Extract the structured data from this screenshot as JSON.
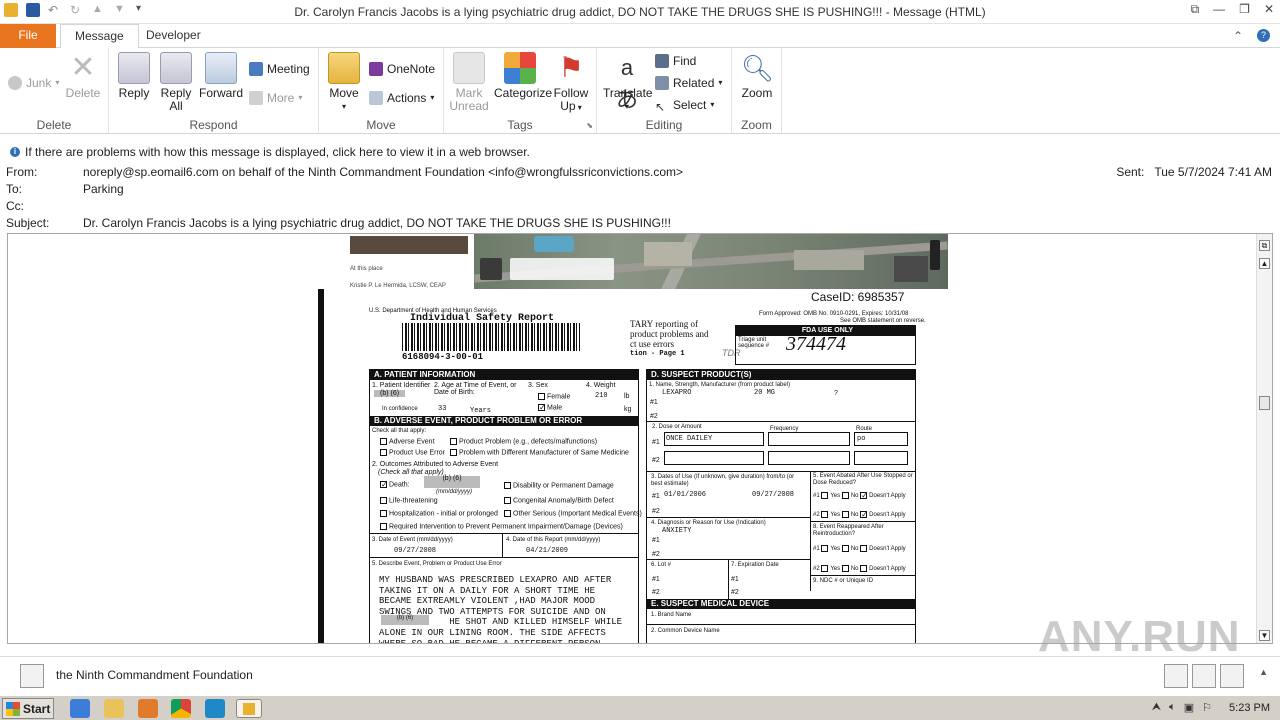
{
  "window": {
    "title": "Dr. Carolyn Francis Jacobs is a lying psychiatric drug addict, DO NOT TAKE THE DRUGS SHE IS PUSHING!!! - Message (HTML)"
  },
  "tabs": {
    "file": "File",
    "message": "Message",
    "developer": "Developer"
  },
  "ribbon": {
    "delete_group": {
      "label": "Delete",
      "junk": "Junk",
      "delete": "Delete"
    },
    "respond_group": {
      "label": "Respond",
      "reply": "Reply",
      "reply_all_1": "Reply",
      "reply_all_2": "All",
      "forward": "Forward",
      "meeting": "Meeting",
      "more": "More"
    },
    "move_group": {
      "label": "Move",
      "move": "Move",
      "onenote": "OneNote",
      "actions": "Actions"
    },
    "tags_group": {
      "label": "Tags",
      "mark_unread_1": "Mark",
      "mark_unread_2": "Unread",
      "categorize": "Categorize",
      "follow_up_1": "Follow",
      "follow_up_2": "Up"
    },
    "editing_group": {
      "label": "Editing",
      "translate": "Translate",
      "find": "Find",
      "related": "Related",
      "select": "Select"
    },
    "zoom_group": {
      "label": "Zoom",
      "zoom": "Zoom"
    }
  },
  "infobar": "If there are problems with how this message is displayed, click here to view it in a web browser.",
  "headers": {
    "from_label": "From:",
    "from": "noreply@sp.eomail6.com on behalf of the Ninth Commandment Foundation <info@wrongfulssriconvictions.com>",
    "to_label": "To:",
    "to": "Parking",
    "cc_label": "Cc:",
    "cc": "",
    "subject_label": "Subject:",
    "subject": "Dr. Carolyn Francis Jacobs is a lying psychiatric drug addict, DO NOT TAKE THE DRUGS SHE IS PUSHING!!!",
    "sent_label": "Sent:",
    "sent": "Tue 5/7/2024 7:41 AM"
  },
  "document": {
    "map_at_place": "At this place",
    "map_person": "Kristie P. Le Hermida, LCSW, CEAP",
    "case_id": "CaseID: 6985357",
    "agency": "U.S. Department of Health and Human Services",
    "form_title": "Individual Safety Report",
    "barcode_number": "6168094-3-00-01",
    "header_text_1": "TARY reporting of",
    "header_text_2": "product problems and",
    "header_text_3": "ct use errors",
    "header_text_4": "tion - Page 1",
    "form_approved": "Form Approved: OMB No. 0910-0291, Expires: 10/31/08",
    "omb_statement": "See OMB statement on reverse.",
    "fda_use_only": "FDA USE ONLY",
    "triage_label": "Triage unit sequence #",
    "triage_value": "374474",
    "sec_a": "A. PATIENT INFORMATION",
    "patient_id_label": "1. Patient Identifier",
    "patient_id_value": "(b) (6)",
    "in_confidence": "In confidence",
    "age_label": "2. Age at Time of Event, or Date of Birth:",
    "age_value": "33",
    "age_unit": "Years",
    "sex_label": "3. Sex",
    "sex_female": "Female",
    "sex_male": "Male",
    "weight_label": "4. Weight",
    "weight_value": "210",
    "weight_lb": "lb",
    "weight_kg": "kg",
    "sec_b": "B. ADVERSE EVENT, PRODUCT PROBLEM OR ERROR",
    "check_all": "Check all that apply:",
    "adverse_event": "Adverse Event",
    "product_problem": "Product Problem (e.g., defects/malfunctions)",
    "product_use_error": "Product Use Error",
    "problem_diff_mfr": "Problem with Different Manufacturer of Same Medicine",
    "outcomes_label": "2. Outcomes Attributed to Adverse Event",
    "outcomes_sub": "(Check all that apply)",
    "death": "Death:",
    "death_redacted": "(b) (6)",
    "date_fmt": "(mm/dd/yyyy)",
    "life_threatening": "Life-threatening",
    "hospitalization": "Hospitalization - initial or prolonged",
    "required_intervention": "Required Intervention to Prevent Permanent Impairment/Damage (Devices)",
    "disability": "Disability or Permanent Damage",
    "congenital": "Congenital Anomaly/Birth Defect",
    "other_serious": "Other Serious (Important Medical Events)",
    "date_event_label": "3. Date of Event (mm/dd/yyyy)",
    "date_event_value": "09/27/2008",
    "date_report_label": "4. Date of this Report (mm/dd/yyyy)",
    "date_report_value": "04/21/2009",
    "describe_label": "5. Describe Event, Problem or Product Use Error",
    "narrative": "MY HUSBAND WAS PRESCRIBED LEXAPRO AND AFTER\nTAKING IT ON A DAILY FOR A SHORT TIME HE\nBECAME EXTREAMLY VIOLENT ,HAD MAJOR MOOD\nSWINGS AND TWO ATTEMPTS FOR SUICIDE AND ON\n             HE SHOT AND KILLED HIMSELF WHILE\nALONE IN OUR LINING ROOM. THE SIDE AFFECTS\nWHERE SO BAD HE BECAME A DIFFERENT PERSON",
    "narrative_redacted": "(b) (6)",
    "sec_d": "D. SUSPECT PRODUCT(S)",
    "name_label": "1. Name, Strength, Manufacturer (from product label)",
    "product_name": "LEXAPRO",
    "product_strength": "20 MG",
    "product_mfr": "?",
    "n1": "#1",
    "n2": "#2",
    "dose_label": "2. Dose or Amount",
    "frequency_label": "Frequency",
    "route_label": "Route",
    "dose_value": "ONCE DAILEY",
    "route_value": "po",
    "dates_use_label": "3. Dates of Use (If unknown, give duration) from/to (or best estimate)",
    "use_from": "01/01/2006",
    "use_to": "09/27/2008",
    "abated_label": "5. Event Abated After Use Stopped or Dose Reduced?",
    "yes": "Yes",
    "no": "No",
    "doesnt_apply": "Doesn't Apply",
    "diagnosis_label": "4. Diagnosis or Reason for Use (Indication)",
    "diagnosis_value": "ANXIETY",
    "reappeared_label": "8. Event Reappeared After Reintroduction?",
    "lot_label": "6. Lot #",
    "expiration_label": "7. Expiration Date",
    "ndc_label": "9. NDC # or Unique ID",
    "sec_e": "E. SUSPECT MEDICAL DEVICE",
    "brand_name": "1. Brand Name",
    "common_device": "2. Common Device Name",
    "tdr": "TDR"
  },
  "footer": {
    "sender_name": "the Ninth Commandment Foundation"
  },
  "taskbar": {
    "start": "Start",
    "clock": "5:23 PM"
  },
  "watermark": "ANY.RUN"
}
